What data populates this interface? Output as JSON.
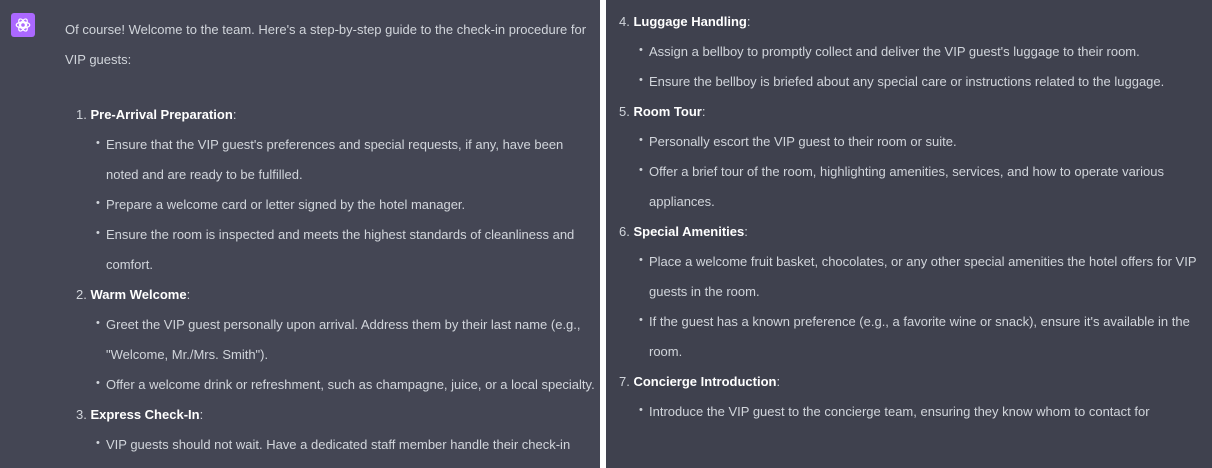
{
  "left": {
    "intro": "Of course! Welcome to the team. Here's a step-by-step guide to the check-in procedure for VIP guests:",
    "steps": [
      {
        "number": "1.",
        "title": "Pre-Arrival Preparation",
        "bullets": [
          "Ensure that the VIP guest's preferences and special requests, if any, have been noted and are ready to be fulfilled.",
          "Prepare a welcome card or letter signed by the hotel manager.",
          "Ensure the room is inspected and meets the highest standards of cleanliness and comfort."
        ]
      },
      {
        "number": "2.",
        "title": "Warm Welcome",
        "bullets": [
          "Greet the VIP guest personally upon arrival. Address them by their last name (e.g., \"Welcome, Mr./Mrs. Smith\").",
          "Offer a welcome drink or refreshment, such as champagne, juice, or a local specialty."
        ]
      },
      {
        "number": "3.",
        "title": "Express Check-In",
        "bullets": [
          "VIP guests should not wait. Have a dedicated staff member handle their check-in swiftly."
        ]
      }
    ]
  },
  "right": {
    "steps": [
      {
        "number": "4.",
        "title": "Luggage Handling",
        "bullets": [
          "Assign a bellboy to promptly collect and deliver the VIP guest's luggage to their room.",
          "Ensure the bellboy is briefed about any special care or instructions related to the luggage."
        ]
      },
      {
        "number": "5.",
        "title": "Room Tour",
        "bullets": [
          "Personally escort the VIP guest to their room or suite.",
          "Offer a brief tour of the room, highlighting amenities, services, and how to operate various appliances."
        ]
      },
      {
        "number": "6.",
        "title": "Special Amenities",
        "bullets": [
          "Place a welcome fruit basket, chocolates, or any other special amenities the hotel offers for VIP guests in the room.",
          "If the guest has a known preference (e.g., a favorite wine or snack), ensure it's available in the room."
        ]
      },
      {
        "number": "7.",
        "title": "Concierge Introduction",
        "bullets": [
          "Introduce the VIP guest to the concierge team, ensuring they know whom to contact for"
        ]
      }
    ]
  },
  "colors": {
    "panel_bg": "#444654",
    "text": "#d1d5db",
    "heading": "#ffffff",
    "avatar": "#ab68ff"
  },
  "icons": {
    "avatar": "openai-logo-icon"
  }
}
